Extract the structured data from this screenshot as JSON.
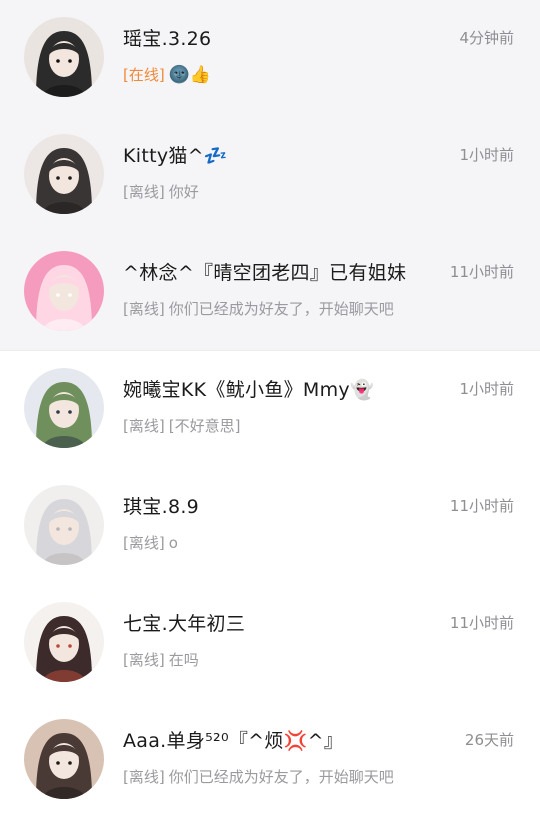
{
  "conversations": [
    {
      "name": "瑶宝.3.26",
      "time": "4分钟前",
      "status": "[在线]",
      "status_type": "online",
      "message": "",
      "emoji": "🌚👍",
      "pinned": true,
      "avatar_colors": [
        "#2b2b2b",
        "#e9e4e0",
        "#111111"
      ]
    },
    {
      "name": "Kitty猫^💤",
      "time": "1小时前",
      "status": "[离线]",
      "status_type": "offline",
      "message": "你好",
      "pinned": true,
      "avatar_colors": [
        "#3a3535",
        "#ece7e4",
        "#201c1c"
      ]
    },
    {
      "name": "^林念^『晴空团老四』已有姐妹",
      "time": "11小时前",
      "status": "[离线]",
      "status_type": "offline",
      "message": "你们已经成为好友了，开始聊天吧",
      "pinned": true,
      "avatar_colors": [
        "#ffd6e4",
        "#f59bbd",
        "#ffffff"
      ]
    },
    {
      "name": "婉曦宝KK《鱿小鱼》Mmy👻",
      "time": "1小时前",
      "status": "[离线]",
      "status_type": "offline",
      "message": "[不好意思]",
      "pinned": false,
      "avatar_colors": [
        "#6f8f5c",
        "#e5e9ef",
        "#2e3a45"
      ]
    },
    {
      "name": "琪宝.8.9",
      "time": "11小时前",
      "status": "[离线]",
      "status_type": "offline",
      "message": "o",
      "pinned": false,
      "avatar_colors": [
        "#d7d7db",
        "#f1efee",
        "#b9b4b4"
      ]
    },
    {
      "name": "七宝.大年初三",
      "time": "11小时前",
      "status": "[离线]",
      "status_type": "offline",
      "message": "在吗",
      "pinned": false,
      "avatar_colors": [
        "#3d2a2a",
        "#f4f1ee",
        "#b84a3a"
      ]
    },
    {
      "name": "Aaa.单身⁵²⁰『^烦💢^』",
      "time": "26天前",
      "status": "[离线]",
      "status_type": "offline",
      "message": "你们已经成为好友了，开始聊天吧",
      "pinned": false,
      "avatar_colors": [
        "#4a3a35",
        "#d8c2b4",
        "#1f1a18"
      ]
    }
  ]
}
